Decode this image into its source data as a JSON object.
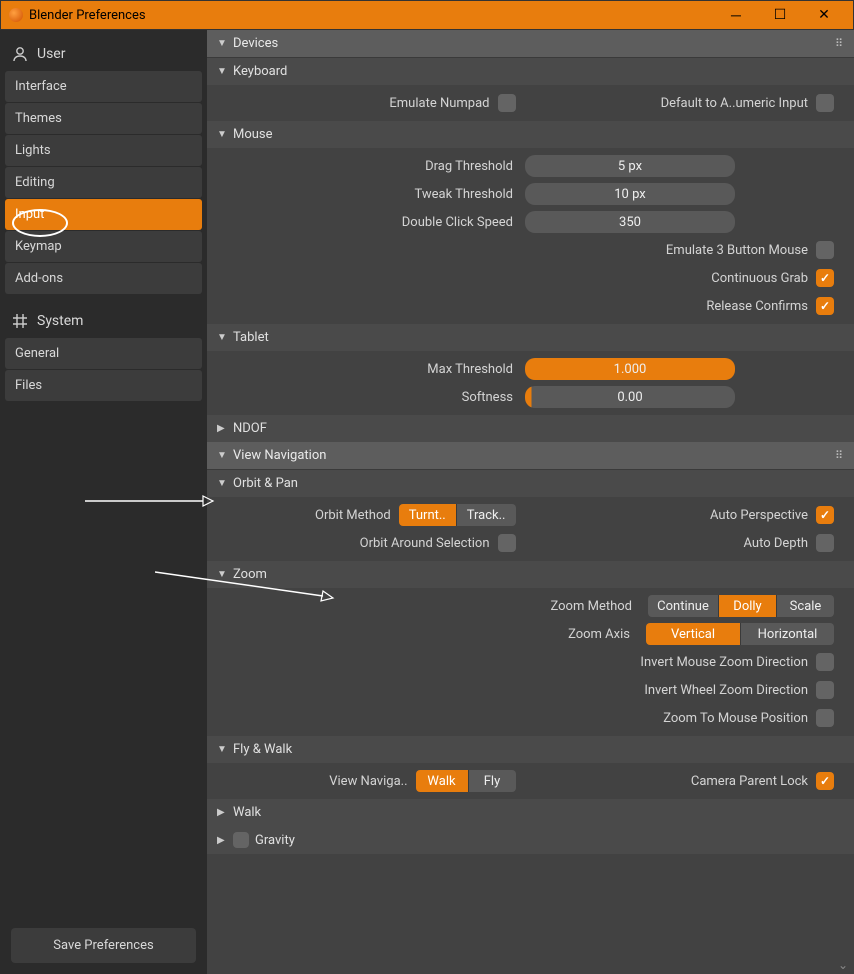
{
  "titlebar": {
    "title": "Blender Preferences"
  },
  "sidebar": {
    "user": {
      "header": "User",
      "items": [
        "Interface",
        "Themes",
        "Lights",
        "Editing",
        "Input",
        "Keymap",
        "Add-ons"
      ],
      "active_index": 4
    },
    "system": {
      "header": "System",
      "items": [
        "General",
        "Files"
      ]
    },
    "save_label": "Save Preferences"
  },
  "panels": {
    "devices": {
      "title": "Devices"
    },
    "keyboard": {
      "title": "Keyboard",
      "emulate_numpad_label": "Emulate Numpad",
      "default_numeric_label": "Default to A..umeric Input"
    },
    "mouse": {
      "title": "Mouse",
      "drag_threshold_label": "Drag Threshold",
      "drag_threshold_value": "5 px",
      "tweak_threshold_label": "Tweak Threshold",
      "tweak_threshold_value": "10 px",
      "double_click_label": "Double Click Speed",
      "double_click_value": "350",
      "emulate_3button_label": "Emulate 3 Button Mouse",
      "continuous_grab_label": "Continuous Grab",
      "release_confirms_label": "Release Confirms"
    },
    "tablet": {
      "title": "Tablet",
      "max_threshold_label": "Max Threshold",
      "max_threshold_value": "1.000",
      "softness_label": "Softness",
      "softness_value": "0.00"
    },
    "ndof": {
      "title": "NDOF"
    },
    "view_nav": {
      "title": "View Navigation"
    },
    "orbit_pan": {
      "title": "Orbit & Pan",
      "orbit_method_label": "Orbit Method",
      "orbit_method_options": [
        "Turnt..",
        "Track.."
      ],
      "orbit_method_active": 0,
      "auto_perspective_label": "Auto Perspective",
      "orbit_around_sel_label": "Orbit Around Selection",
      "auto_depth_label": "Auto Depth"
    },
    "zoom": {
      "title": "Zoom",
      "zoom_method_label": "Zoom Method",
      "zoom_method_options": [
        "Continue",
        "Dolly",
        "Scale"
      ],
      "zoom_method_active": 1,
      "zoom_axis_label": "Zoom Axis",
      "zoom_axis_options": [
        "Vertical",
        "Horizontal"
      ],
      "zoom_axis_active": 0,
      "invert_mouse_label": "Invert Mouse Zoom Direction",
      "invert_wheel_label": "Invert Wheel Zoom Direction",
      "zoom_to_mouse_label": "Zoom To Mouse Position"
    },
    "fly_walk": {
      "title": "Fly & Walk",
      "view_nav_label": "View Naviga..",
      "view_nav_options": [
        "Walk",
        "Fly"
      ],
      "view_nav_active": 0,
      "camera_parent_label": "Camera Parent Lock"
    },
    "walk": {
      "title": "Walk"
    },
    "gravity": {
      "title": "Gravity"
    }
  }
}
